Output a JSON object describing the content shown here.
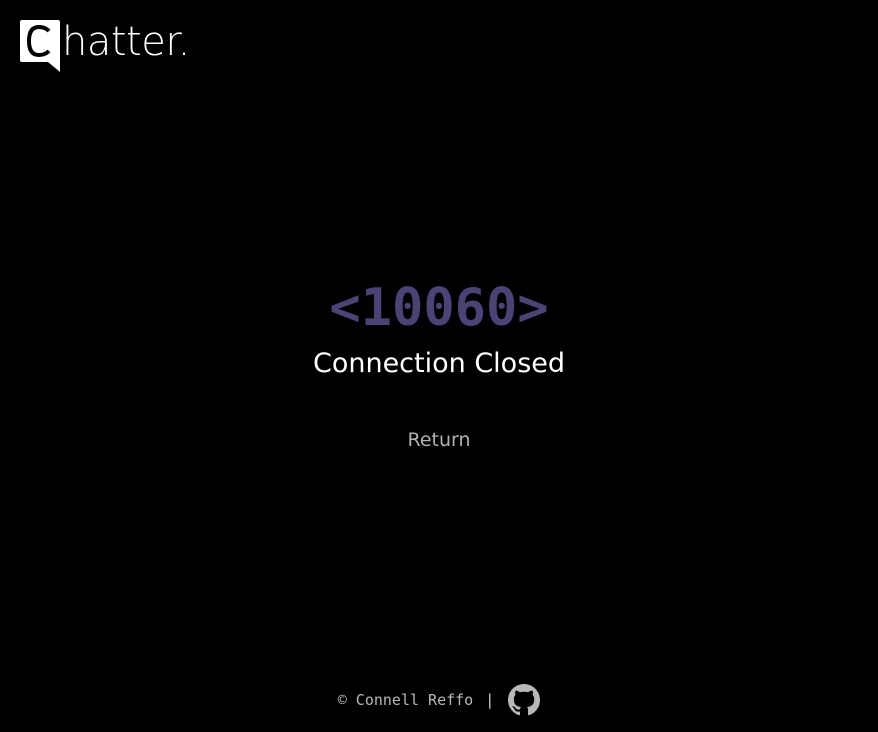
{
  "brand": {
    "name": "hatter."
  },
  "error": {
    "code": "<10060>",
    "message": "Connection Closed"
  },
  "actions": {
    "return_label": "Return"
  },
  "footer": {
    "copyright": "© Connell Reffo",
    "separator": "|",
    "github_icon": "github-icon"
  },
  "colors": {
    "background": "#000000",
    "error_code": "#4b4275",
    "text": "#ffffff",
    "muted": "#b0b0b0"
  }
}
